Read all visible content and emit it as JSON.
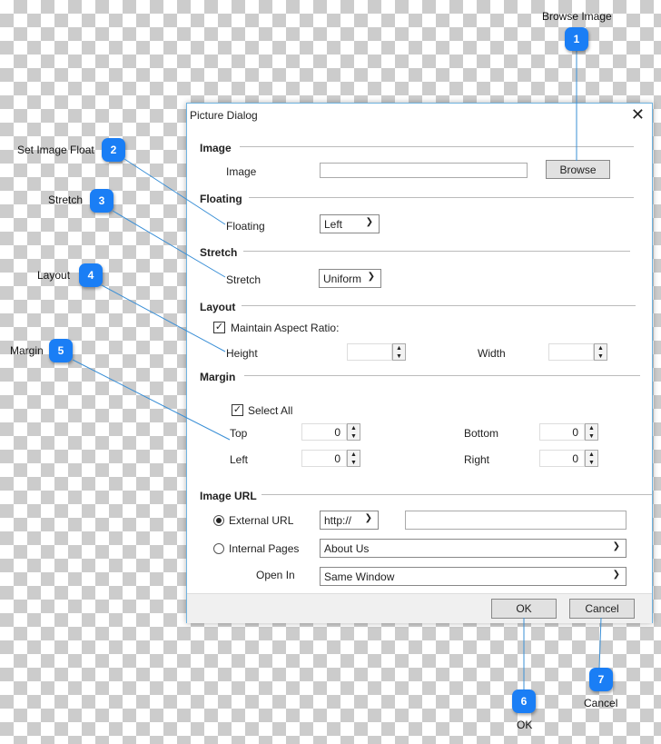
{
  "callouts": [
    {
      "num": "1",
      "label": "Browse Image"
    },
    {
      "num": "2",
      "label": "Set Image Float"
    },
    {
      "num": "3",
      "label": "Stretch"
    },
    {
      "num": "4",
      "label": "Layout"
    },
    {
      "num": "5",
      "label": "Margin"
    },
    {
      "num": "6",
      "label": "OK"
    },
    {
      "num": "7",
      "label": "Cancel"
    }
  ],
  "colors": {
    "badge": "#1a7ef5",
    "connector": "#3a8fd6"
  },
  "dialog": {
    "title": "Picture Dialog",
    "close_icon": "close-icon",
    "image": {
      "section": "Image",
      "label": "Image",
      "value": "",
      "browse": "Browse"
    },
    "floating": {
      "section": "Floating",
      "label": "Floating",
      "value": "Left"
    },
    "stretch": {
      "section": "Stretch",
      "label": "Stretch",
      "value": "Uniform"
    },
    "layout": {
      "section": "Layout",
      "maintain": "Maintain Aspect Ratio:",
      "maintain_checked": true,
      "height_label": "Height",
      "height": "",
      "width_label": "Width",
      "width": ""
    },
    "margin": {
      "section": "Margin",
      "select_all": "Select All",
      "select_all_checked": true,
      "top_label": "Top",
      "top": "0",
      "bottom_label": "Bottom",
      "bottom": "0",
      "left_label": "Left",
      "left": "0",
      "right_label": "Right",
      "right": "0"
    },
    "url": {
      "section": "Image URL",
      "external": "External URL",
      "external_selected": true,
      "protocol": "http://",
      "url": "",
      "internal": "Internal Pages",
      "page": "About Us",
      "open_in_label": "Open In",
      "open_in": "Same Window"
    },
    "ok": "OK",
    "cancel": "Cancel"
  }
}
